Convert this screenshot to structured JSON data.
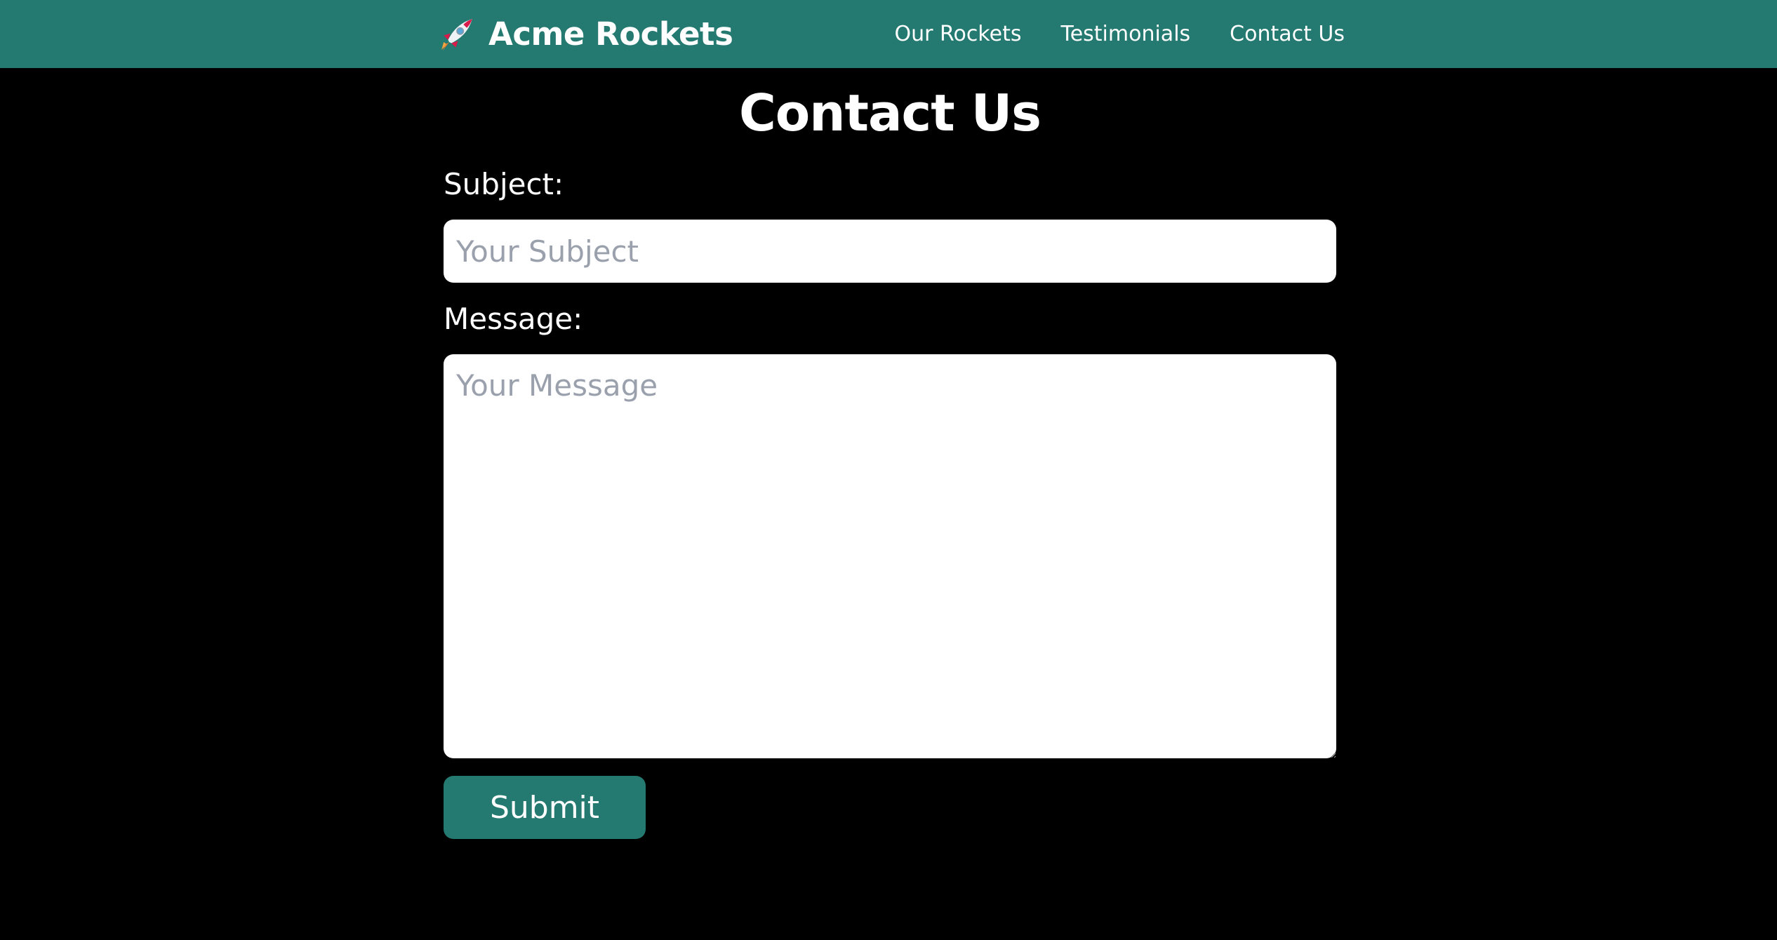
{
  "header": {
    "brand_name": "Acme Rockets",
    "brand_icon": "rocket-icon",
    "background_color": "#247970",
    "nav": [
      {
        "label": "Our Rockets"
      },
      {
        "label": "Testimonials"
      },
      {
        "label": "Contact Us"
      }
    ]
  },
  "main": {
    "title": "Contact Us",
    "form": {
      "subject_label": "Subject:",
      "subject_placeholder": "Your Subject",
      "subject_value": "",
      "message_label": "Message:",
      "message_placeholder": "Your Message",
      "message_value": "",
      "submit_label": "Submit"
    }
  },
  "colors": {
    "page_background": "#000000",
    "accent": "#247970",
    "text": "#ffffff",
    "placeholder": "#9aa1ad"
  }
}
